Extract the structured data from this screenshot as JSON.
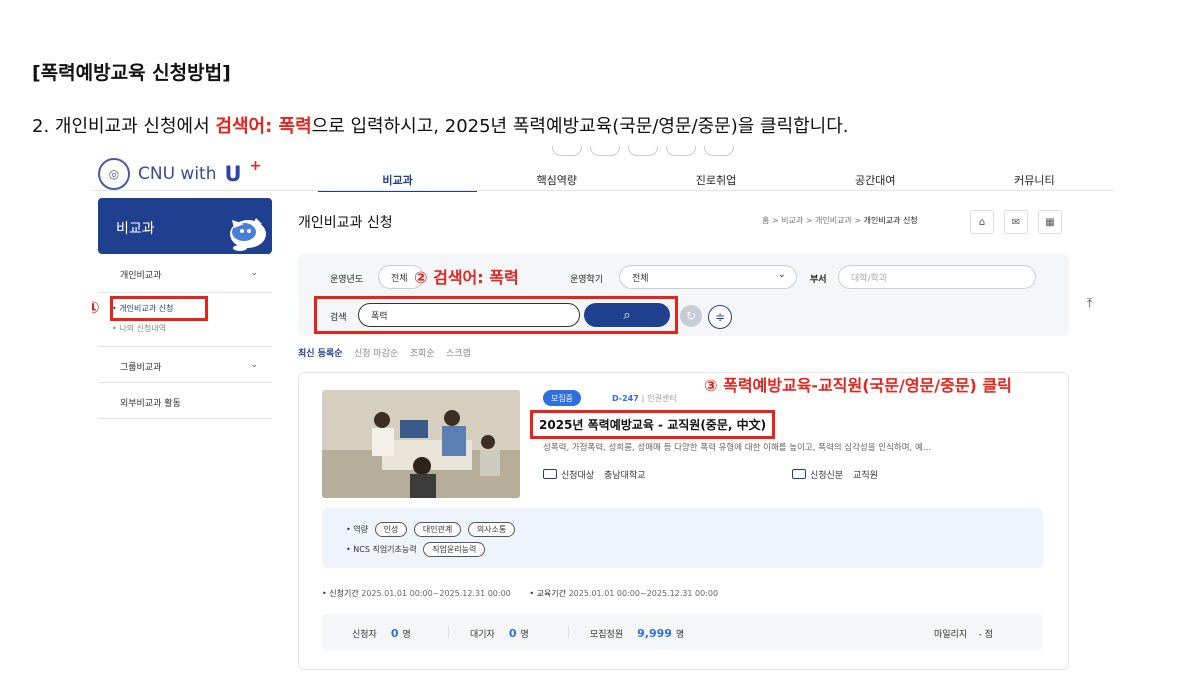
{
  "doc": {
    "title": "[폭력예방교육 신청방법]",
    "instruction_pre": "2. 개인비교과 신청에서 ",
    "instruction_hl": "검색어: 폭력",
    "instruction_post": "으로 입력하시고, 2025년 폭력예방교육(국문/영문/중문)을 클릭합니다."
  },
  "site": {
    "logo_text": "CNU with",
    "logo_u": "U",
    "logo_plus": "+"
  },
  "gnb": [
    "비교과",
    "핵심역량",
    "진로취업",
    "공간대여",
    "커뮤니티"
  ],
  "sidebar": {
    "header": "비교과",
    "items": [
      "개인비교과",
      "그룹비교과",
      "외부비교과 활동"
    ],
    "sub_items": [
      "• 개인비교과 신청",
      "• 나의 신청내역"
    ]
  },
  "page": {
    "title": "개인비교과 신청",
    "breadcrumb": "홈 > 비교과 > 개인비교과 > ",
    "breadcrumb_current": "개인비교과 신청"
  },
  "search": {
    "year_label": "운영년도",
    "year_value": "전체",
    "semester_label": "운영학기",
    "semester_value": "전체",
    "dept_label": "부서",
    "dept_placeholder": "대학/학과",
    "keyword_label": "검색",
    "keyword_value": "폭력"
  },
  "sort": [
    "최신 등록순",
    "신청 마감순",
    "조회순",
    "스크랩"
  ],
  "card": {
    "status": "모집중",
    "dday": "D-247",
    "org": "인권센터",
    "title": "2025년 폭력예방교육 - 교직원(중문, 中文)",
    "desc": "성폭력, 가정폭력, 성희롱, 성매매 등 다양한 폭력 유형에 대한 이해를 높이고, 폭력의 심각성을 인식하며, 예…",
    "target_label": "신청대상",
    "target_value": "충남대학교",
    "role_label": "신청신분",
    "role_value": "교직원",
    "competency_label": "• 역량",
    "competencies": [
      "인성",
      "대인관계",
      "의사소통"
    ],
    "ncs_label": "• NCS 직업기초능력",
    "ncs": [
      "직업윤리능력"
    ],
    "apply_period_label": "• 신청기간",
    "apply_period": "2025.01.01 00:00~2025.12.31 00:00",
    "edu_period_label": "• 교육기간",
    "edu_period": "2025.01.01 00:00~2025.12.31 00:00",
    "applicants_label": "신청자",
    "applicants": "0",
    "waiting_label": "대기자",
    "waiting": "0",
    "capacity_label": "모집정원",
    "capacity": "9,999",
    "unit": "명",
    "mileage_label": "마일리지",
    "mileage": "- 점"
  },
  "annotations": {
    "step1": "①",
    "step2": "② 검색어: 폭력",
    "step3": "③ 폭력예방교육-교직원(국문/영문/중문) 클릭"
  },
  "colors": {
    "accent": "#1f3f8f",
    "highlight": "#e8231c",
    "badge": "#2f6fe0"
  }
}
